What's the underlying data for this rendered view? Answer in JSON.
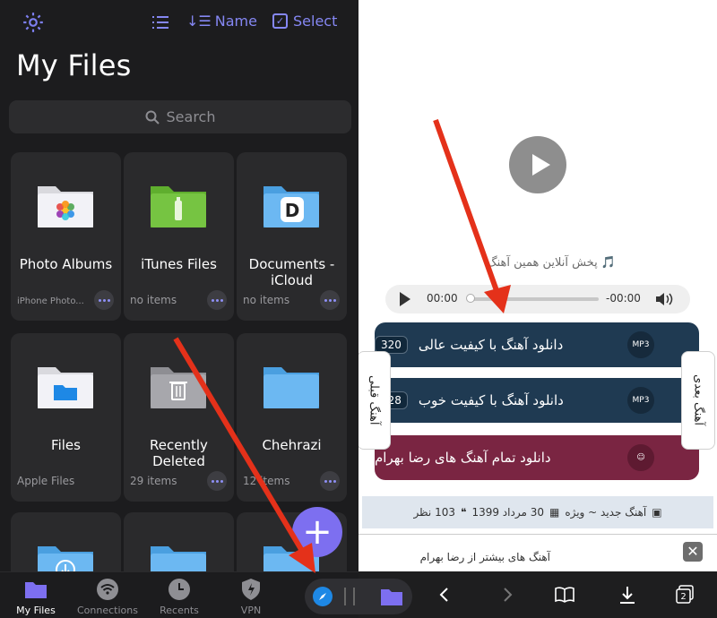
{
  "left": {
    "toolbar": {
      "sort_label": "Name",
      "select_label": "Select"
    },
    "title": "My Files",
    "search_placeholder": "Search",
    "tiles": [
      {
        "name": "Photo Albums",
        "sub": "iPhone Photo...",
        "icon": "photos-folder-icon"
      },
      {
        "name": "iTunes Files",
        "sub": "no items",
        "icon": "itunes-folder-icon"
      },
      {
        "name": "Documents - iCloud",
        "sub": "no items",
        "icon": "documents-folder-icon"
      },
      {
        "name": "Files",
        "sub": "Apple Files",
        "icon": "files-folder-icon"
      },
      {
        "name": "Recently Deleted",
        "sub": "29 items",
        "icon": "trash-folder-icon"
      },
      {
        "name": "Chehrazi",
        "sub": "12 items",
        "icon": "folder-icon"
      }
    ],
    "tabs": [
      {
        "label": "My Files",
        "icon": "folder-icon",
        "active": true
      },
      {
        "label": "Connections",
        "icon": "wifi-icon",
        "active": false
      },
      {
        "label": "Recents",
        "icon": "clock-icon",
        "active": false
      },
      {
        "label": "VPN",
        "icon": "shield-icon",
        "active": false
      }
    ],
    "colors": {
      "accent": "#7d7ff0",
      "background": "#1c1c1e",
      "tile": "#2a2a2c"
    }
  },
  "right": {
    "online_label": "پخش آنلاین همین آهنگ",
    "audio": {
      "current": "00:00",
      "remaining": "-00:00"
    },
    "downloads": [
      {
        "label": "دانلود آهنگ با کیفیت عالی",
        "badge": "320",
        "icon": "MP3"
      },
      {
        "label": "دانلود آهنگ با کیفیت خوب",
        "badge": "128",
        "icon": "MP3"
      },
      {
        "label": "دانلود تمام آهنگ های رضا بهرام",
        "badge": "",
        "icon": "user-icon"
      }
    ],
    "side_prev": "آهنگ قبلی",
    "side_next": "آهنگ بعدی",
    "meta": {
      "category": "آهنگ جدید ~ ویژه",
      "date": "30 مرداد 1399",
      "comments": "103 نظر"
    },
    "related_title": "آهنگ های بیشتر از رضا بهرام",
    "colors": {
      "download": "#1f3a52",
      "all_songs": "#7a2542",
      "arrow": "#e4311a"
    }
  }
}
